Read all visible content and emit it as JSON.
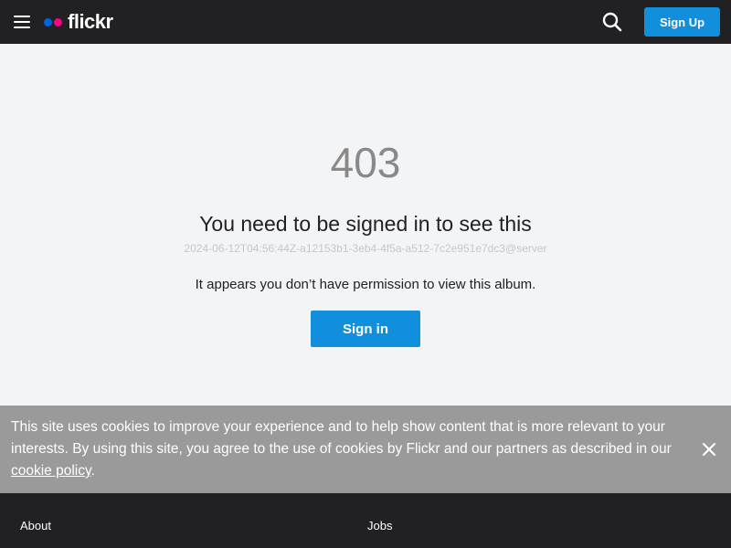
{
  "header": {
    "logo_text": "flickr",
    "signup_label": "Sign Up",
    "icons": {
      "menu": "hamburger-menu-icon",
      "search": "search-icon"
    },
    "colors": {
      "bar": "#212124",
      "logo_blue": "#0063dc",
      "logo_pink": "#ff0084",
      "accent": "#128fdc"
    }
  },
  "error": {
    "code": "403",
    "title": "You need to be signed in to see this",
    "trace_id": "2024-06-12T04:56:44Z-a12153b1-3eb4-4f5a-a512-7c2e951e7dc3@server",
    "message": "It appears you don’t have permission to view this album.",
    "signin_label": "Sign in"
  },
  "cookie_banner": {
    "text": "This site uses cookies to improve your experience and to help show content that is more relevant to your interests. By using this site, you agree to the use of cookies by Flickr and our partners as described in our",
    "link_text": "cookie policy",
    "suffix": ".",
    "close_icon": "close-icon",
    "background": "#9a9a9a"
  },
  "footer": {
    "links": [
      "About",
      "Jobs"
    ]
  }
}
